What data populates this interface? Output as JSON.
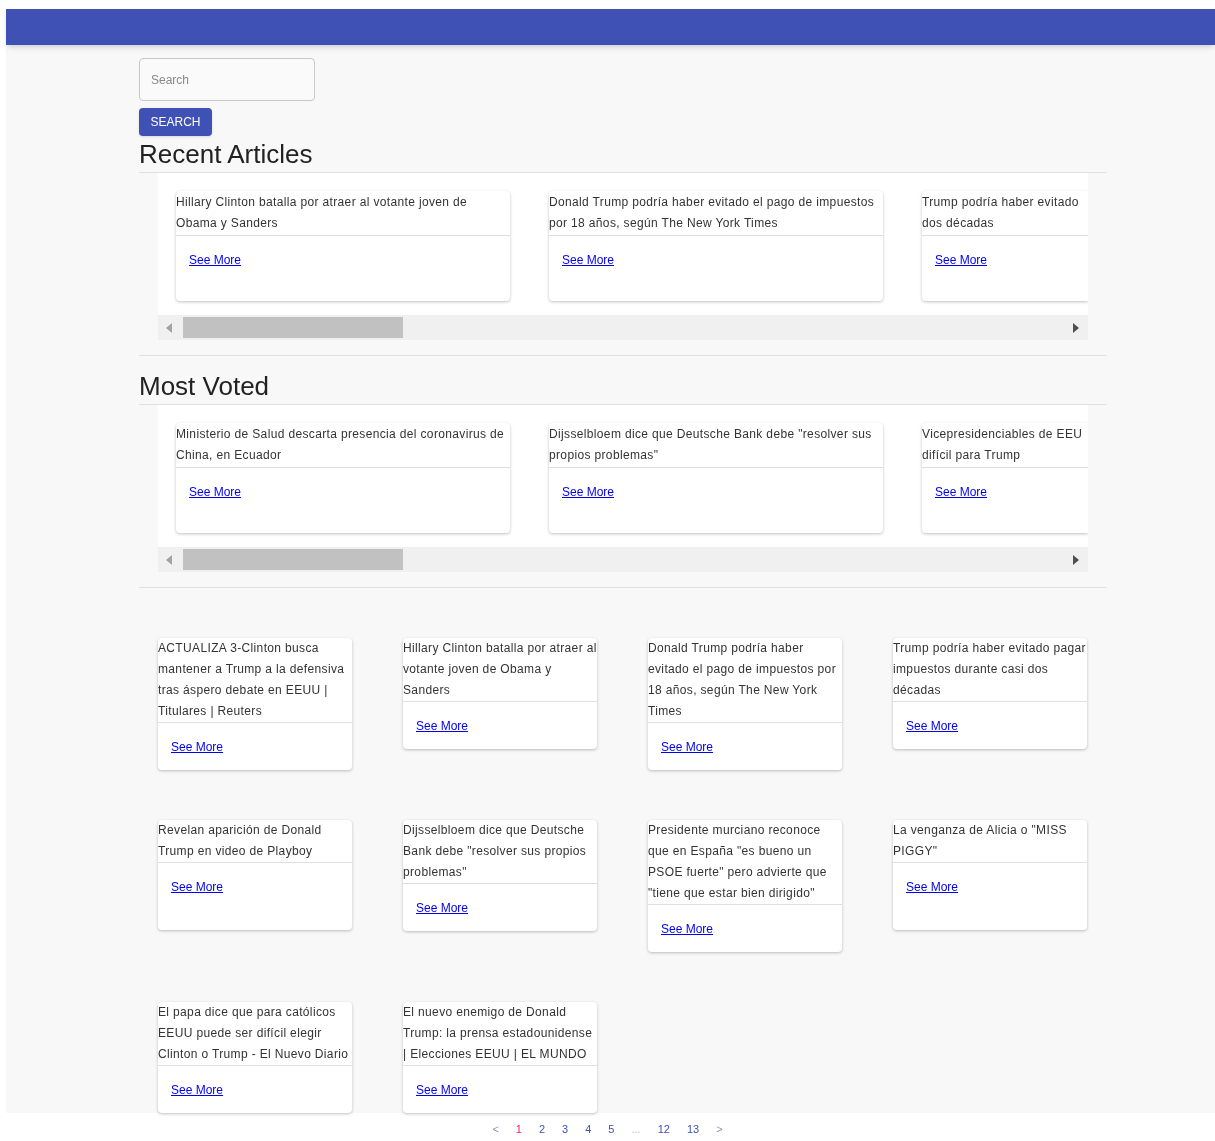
{
  "search": {
    "placeholder": "Search",
    "button": "SEARCH"
  },
  "sections": [
    {
      "title": "Recent Articles",
      "cards": [
        {
          "title": "Hillary Clinton batalla por atraer al votante joven de Obama y Sanders",
          "link": "See More",
          "cut": false
        },
        {
          "title": "Donald Trump podría haber evitado el pago de impuestos por 18 años, según The New York Times",
          "link": "See More",
          "cut": false
        },
        {
          "title": "Trump podría haber evitado\ndos décadas",
          "link": "See More",
          "cut": true
        }
      ]
    },
    {
      "title": "Most Voted",
      "cards": [
        {
          "title": "Ministerio de Salud descarta presencia del coronavirus de China, en Ecuador",
          "link": "See More",
          "cut": false
        },
        {
          "title": "Dijsselbloem dice que Deutsche Bank debe \"resolver sus propios problemas\"",
          "link": "See More",
          "cut": false
        },
        {
          "title": "Vicepresidenciables de EEU\ndifícil para Trump",
          "link": "See More",
          "cut": true
        }
      ]
    }
  ],
  "grid": [
    {
      "title": "ACTUALIZA 3-Clinton busca mantener a Trump a la defensiva tras áspero debate en EEUU | Titulares | Reuters",
      "link": "See More"
    },
    {
      "title": "Hillary Clinton batalla por atraer al votante joven de Obama y Sanders",
      "link": "See More"
    },
    {
      "title": "Donald Trump podría haber evitado el pago de impuestos por 18 años, según The New York Times",
      "link": "See More"
    },
    {
      "title": "Trump podría haber evitado pagar impuestos durante casi dos décadas",
      "link": "See More"
    },
    {
      "title": "Revelan aparición de Donald Trump en video de Playboy",
      "link": "See More"
    },
    {
      "title": "Dijsselbloem dice que Deutsche Bank debe \"resolver sus propios problemas\"",
      "link": "See More"
    },
    {
      "title": "Presidente murciano reconoce que en España \"es bueno un PSOE fuerte\" pero advierte que \"tiene que estar bien dirigido\"",
      "link": "See More"
    },
    {
      "title": "La venganza de Alicia o \"MISS PIGGY\"",
      "link": "See More"
    },
    {
      "title": "El papa dice que para católicos EEUU puede ser difícil elegir Clinton o Trump - El Nuevo Diario",
      "link": "See More"
    },
    {
      "title": "El nuevo enemigo de Donald Trump: la prensa estadounidense | Elecciones EEUU | EL MUNDO",
      "link": "See More"
    }
  ],
  "pagination": [
    {
      "label": "<",
      "kind": "arrow",
      "selected": false
    },
    {
      "label": "1",
      "kind": "page",
      "selected": true
    },
    {
      "label": "2",
      "kind": "page",
      "selected": false
    },
    {
      "label": "3",
      "kind": "page",
      "selected": false
    },
    {
      "label": "4",
      "kind": "page",
      "selected": false
    },
    {
      "label": "5",
      "kind": "page",
      "selected": false
    },
    {
      "label": "...",
      "kind": "gap",
      "selected": false
    },
    {
      "label": "12",
      "kind": "page",
      "selected": false
    },
    {
      "label": "13",
      "kind": "page",
      "selected": false
    },
    {
      "label": ">",
      "kind": "arrow",
      "selected": false
    }
  ]
}
